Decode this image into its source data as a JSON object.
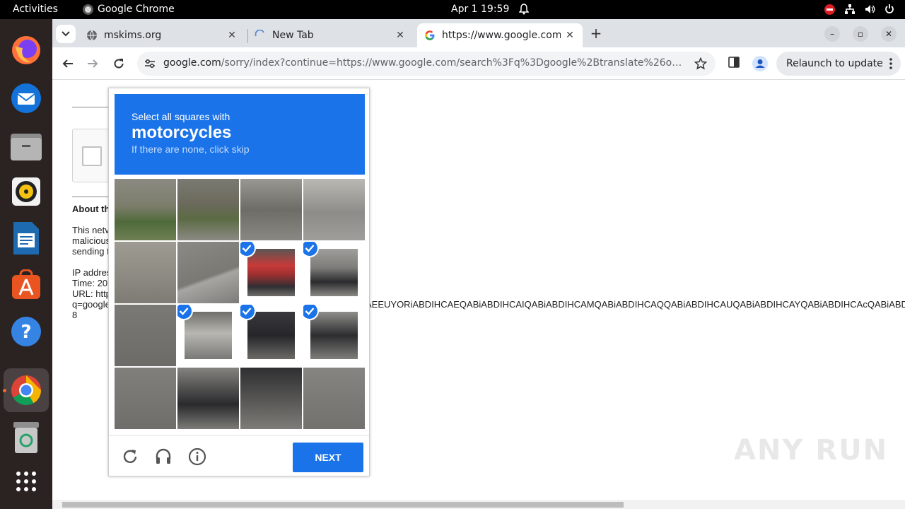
{
  "system": {
    "activities": "Activities",
    "app_name": "Google Chrome",
    "clock": "Apr 1  19:59"
  },
  "tabs": [
    {
      "title": "mskims.org"
    },
    {
      "title": "New Tab"
    },
    {
      "title": "https://www.google.com"
    }
  ],
  "toolbar": {
    "url_host": "google.com",
    "url_path": "/sorry/index?continue=https://www.google.com/search%3Fq%3Dgoogle%2Btranslate%26oq%3Dgoogl…",
    "relaunch_label": "Relaunch to update"
  },
  "page": {
    "about_title": "About th",
    "para_lines": [
      "This netv",
      "malicious",
      "sending t"
    ],
    "info_lines": [
      "IP addres",
      "Time: 20",
      "URL: http",
      "q=google",
      "8"
    ],
    "long_line": "AEEUYORiABDIHCAEQABiABDIHCAIQABiABDIHCAMQABiABDIHCAQQABiABDIHCAUQABiABDIHCAYQABiABDIHCAcQABiABD"
  },
  "captcha": {
    "instruction": "Select all squares with",
    "target": "motorcycles",
    "hint": "If there are none, click skip",
    "next_label": "NEXT",
    "selected_tiles": [
      6,
      7,
      9,
      10,
      11
    ]
  },
  "watermark": "ANY RUN",
  "colors": {
    "accent": "#1a73e8",
    "dock": "#2b2222",
    "topbar": "#000000"
  }
}
